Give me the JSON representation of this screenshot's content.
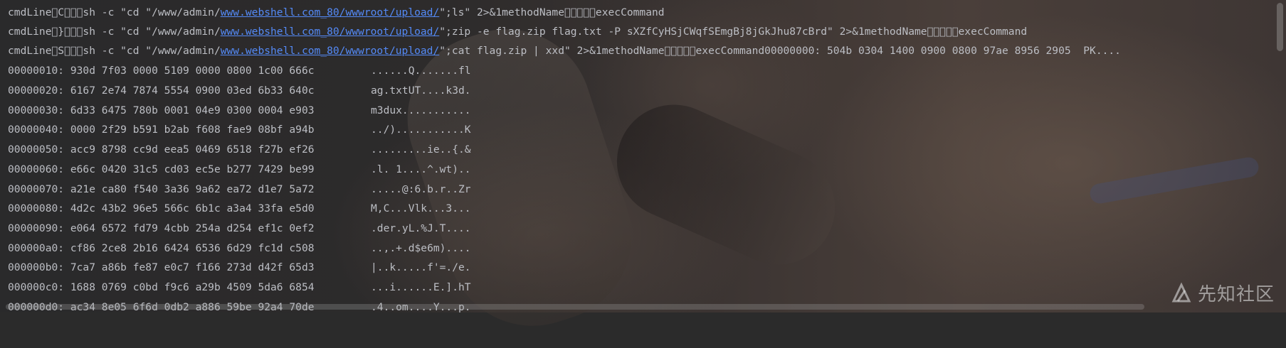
{
  "console": {
    "cmd_lines": [
      {
        "prefix": "cmdLine\u0000C\u0000\u0000\u0000sh -c \"cd \"/www/admin/",
        "link": "www.webshell.com_80/wwwroot/upload/",
        "suffix": "\";ls\" 2>&1methodName\u0000\u0000\u0000\u0000\u0000execCommand"
      },
      {
        "prefix": "cmdLine\u0000}\u0000\u0000\u0000sh -c \"cd \"/www/admin/",
        "link": "www.webshell.com_80/wwwroot/upload/",
        "suffix": "\";zip -e flag.zip flag.txt -P sXZfCyHSjCWqfSEmgBj8jGkJhu87cBrd\" 2>&1methodName\u0000\u0000\u0000\u0000\u0000execCommand"
      },
      {
        "prefix": "cmdLine\u0000S\u0000\u0000\u0000sh -c \"cd \"/www/admin/",
        "link": "www.webshell.com_80/wwwroot/upload/",
        "suffix": "\";cat flag.zip | xxd\" 2>&1methodName\u0000\u0000\u0000\u0000\u0000execCommand00000000: 504b 0304 1400 0900 0800 97ae 8956 2905  PK...."
      }
    ],
    "hex_lines": [
      {
        "hex": "00000010: 930d 7f03 0000 5109 0000 0800 1c00 666c",
        "ascii": "......Q.......fl"
      },
      {
        "hex": "00000020: 6167 2e74 7874 5554 0900 03ed 6b33 640c",
        "ascii": "ag.txtUT....k3d."
      },
      {
        "hex": "00000030: 6d33 6475 780b 0001 04e9 0300 0004 e903",
        "ascii": "m3dux..........."
      },
      {
        "hex": "00000040: 0000 2f29 b591 b2ab f608 fae9 08bf a94b",
        "ascii": "../)...........K"
      },
      {
        "hex": "00000050: acc9 8798 cc9d eea5 0469 6518 f27b ef26",
        "ascii": ".........ie..{.&"
      },
      {
        "hex": "00000060: e66c 0420 31c5 cd03 ec5e b277 7429 be99",
        "ascii": ".l. 1....^.wt).."
      },
      {
        "hex": "00000070: a21e ca80 f540 3a36 9a62 ea72 d1e7 5a72",
        "ascii": ".....@:6.b.r..Zr"
      },
      {
        "hex": "00000080: 4d2c 43b2 96e5 566c 6b1c a3a4 33fa e5d0",
        "ascii": "M,C...Vlk...3..."
      },
      {
        "hex": "00000090: e064 6572 fd79 4cbb 254a d254 ef1c 0ef2",
        "ascii": ".der.yL.%J.T...."
      },
      {
        "hex": "000000a0: cf86 2ce8 2b16 6424 6536 6d29 fc1d c508",
        "ascii": "..,.+.d$e6m)...."
      },
      {
        "hex": "000000b0: 7ca7 a86b fe87 e0c7 f166 273d d42f 65d3",
        "ascii": "|..k.....f'=./e."
      },
      {
        "hex": "000000c0: 1688 0769 c0bd f9c6 a29b 4509 5da6 6854",
        "ascii": "...i......E.].hT"
      },
      {
        "hex": "000000d0: ac34 8e05 6f6d 0db2 a886 59be 92a4 70de",
        "ascii": ".4..om....Y...p."
      }
    ]
  },
  "watermark": {
    "text": "先知社区"
  },
  "colors": {
    "background": "#2b2b2b",
    "text": "#bcbec4",
    "link": "#548af7"
  }
}
